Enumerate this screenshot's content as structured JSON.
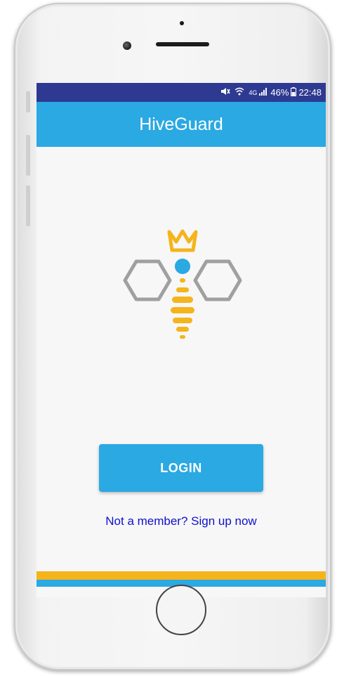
{
  "status_bar": {
    "icons": [
      "mute-icon",
      "wifi-icon",
      "signal-4g-icon",
      "battery-icon"
    ],
    "network": "4G",
    "battery": "46%",
    "time": "22:48"
  },
  "app_bar": {
    "title": "HiveGuard"
  },
  "logo": {
    "name": "hiveguard-bee-logo",
    "colors": {
      "crown": "#f5b41b",
      "hexagon": "#a0a0a0",
      "dot": "#2aa9e3",
      "body": "#f5b41b"
    }
  },
  "login": {
    "label": "LOGIN"
  },
  "signup": {
    "text": "Not a member? Sign up now"
  },
  "colors": {
    "status_bar": "#2e3a91",
    "primary": "#2aa9e3",
    "accent": "#f5b41b",
    "link": "#1010cc"
  }
}
